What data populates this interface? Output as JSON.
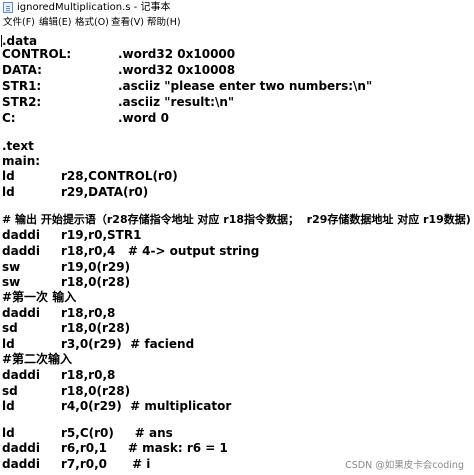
{
  "window": {
    "title": "ignoredMultiplication.s - 记事本",
    "menu": [
      "文件(F)",
      "编辑(E)",
      "格式(O)",
      "查看(V)",
      "帮助(H)"
    ]
  },
  "code": {
    "data_directive": ".data",
    "defs": [
      {
        "name": "CONTROL:",
        "value": ".word32 0x10000"
      },
      {
        "name": "DATA:",
        "value": ".word32 0x10008"
      },
      {
        "name": "STR1:",
        "value": ".asciiz \"please enter two numbers:\\n\""
      },
      {
        "name": "STR2:",
        "value": ".asciiz \"result:\\n\""
      },
      {
        "name": "C:",
        "value": ".word 0"
      }
    ],
    "text_directive": ".text",
    "main_label": "main:",
    "instr1": {
      "op": "ld",
      "args": "r28,CONTROL(r0)"
    },
    "instr2": {
      "op": "ld",
      "args": "r29,DATA(r0)"
    },
    "comment1": "# 输出 开始提示语（r28存储指令地址 对应 r18指令数据；  r29存储数据地址 对应 r19数据)",
    "instr3": {
      "op": "daddi",
      "args": "r19,r0,STR1"
    },
    "instr4": {
      "op": "daddi",
      "args": "r18,r0,4   # 4-> output string"
    },
    "instr5": {
      "op": "sw",
      "args": "r19,0(r29)"
    },
    "instr6": {
      "op": "sw",
      "args": "r18,0(r28)"
    },
    "comment2": "#第一次 输入",
    "instr7": {
      "op": "daddi",
      "args": "r18,r0,8"
    },
    "instr8": {
      "op": "sd",
      "args": "r18,0(r28)"
    },
    "instr9": {
      "op": "ld",
      "args": "r3,0(r29)  # faciend"
    },
    "comment3": "#第二次输入",
    "instr10": {
      "op": "daddi",
      "args": "r18,r0,8"
    },
    "instr11": {
      "op": "sd",
      "args": "r18,0(r28)"
    },
    "instr12": {
      "op": "ld",
      "args": "r4,0(r29)  # multiplicator"
    },
    "instr13": {
      "op": "ld",
      "args": "r5,C(r0)     # ans"
    },
    "instr14": {
      "op": "daddi",
      "args": "r6,r0,1     # mask: r6 = 1"
    },
    "instr15": {
      "op": "daddi",
      "args": "r7,r0,0      # i"
    }
  },
  "watermark": "CSDN @如果皮卡会coding"
}
